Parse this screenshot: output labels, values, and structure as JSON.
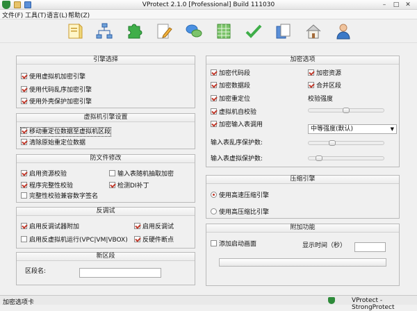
{
  "window": {
    "title": "VProtect 2.1.0 [Professional] Build 111030",
    "minimize": "–",
    "maximize": "□",
    "close": "✕"
  },
  "menu": {
    "file": "文件(F)",
    "tools": "工具(T)",
    "language": "语言(L)",
    "help": "帮助(Z)"
  },
  "toolbar": [
    "file-open-icon",
    "network-icon",
    "puzzle-icon",
    "edit-document-icon",
    "chat-bubbles-icon",
    "spreadsheet-icon",
    "checkmark-icon",
    "copy-document-icon",
    "house-icon",
    "user-icon"
  ],
  "engine": {
    "title": "引擎选择",
    "items": [
      {
        "label": "使用虚拟机加密引擎",
        "checked": true
      },
      {
        "label": "使用代码乱序加密引擎",
        "checked": true
      },
      {
        "label": "使用外壳保护加密引擎",
        "checked": true
      }
    ]
  },
  "vm": {
    "title": "虚拟机引擎设置",
    "items": [
      {
        "label": "移动重定位数据至虚拟机区段",
        "checked": true
      },
      {
        "label": "清除原始重定位数据",
        "checked": true
      }
    ]
  },
  "antifile": {
    "title": "防文件修改",
    "left": [
      {
        "label": "启用资源校验",
        "checked": true
      },
      {
        "label": "程序完整性校验",
        "checked": true
      },
      {
        "label": "完整性校验兼容数字签名",
        "checked": false
      }
    ],
    "right": [
      {
        "label": "输入表随机抽取加密",
        "checked": false
      },
      {
        "label": "检测DI补丁",
        "checked": true
      }
    ]
  },
  "antidebug": {
    "title": "反调试",
    "left": [
      {
        "label": "启用反调试器附加",
        "checked": true
      },
      {
        "label": "启用反虚拟机运行(VPC|VM|VBOX)",
        "checked": false
      }
    ],
    "right": [
      {
        "label": "启用反调试",
        "checked": true
      },
      {
        "label": "反硬件断点",
        "checked": true
      }
    ]
  },
  "section": {
    "title": "新区段",
    "name_label": "区段名:",
    "name_value": ""
  },
  "encrypt": {
    "title": "加密选项",
    "left": [
      {
        "label": "加密代码段",
        "checked": true
      },
      {
        "label": "加密数据段",
        "checked": true
      },
      {
        "label": "加密重定位",
        "checked": true
      },
      {
        "label": "虚拟机自校验",
        "checked": true
      },
      {
        "label": "加密输入表调用",
        "checked": true
      }
    ],
    "right": [
      {
        "label": "加密资源",
        "checked": true
      },
      {
        "label": "合并区段",
        "checked": true
      }
    ],
    "strength_label": "校验强度",
    "strength_level": 0.5,
    "select_value": "中等强度(默认)",
    "iat_out_label": "输入表乱序保护数:",
    "iat_out_level": 0.3,
    "iat_vm_label": "输入表虚拟保护数:",
    "iat_vm_level": 0.1
  },
  "compress": {
    "title": "压缩引擎",
    "options": [
      {
        "label": "使用高速压缩引擎",
        "selected": true
      },
      {
        "label": "使用高压缩比引擎",
        "selected": false
      }
    ]
  },
  "extra": {
    "title": "附加功能",
    "splash_label": "添加启动画面",
    "splash_checked": false,
    "time_label": "显示时间（秒）",
    "time_value": ""
  },
  "status": {
    "left": "加密选项卡",
    "right": "VProtect - StrongProtect"
  },
  "colors": {
    "check": "#c0392b",
    "brand": "#2e8b3a"
  }
}
